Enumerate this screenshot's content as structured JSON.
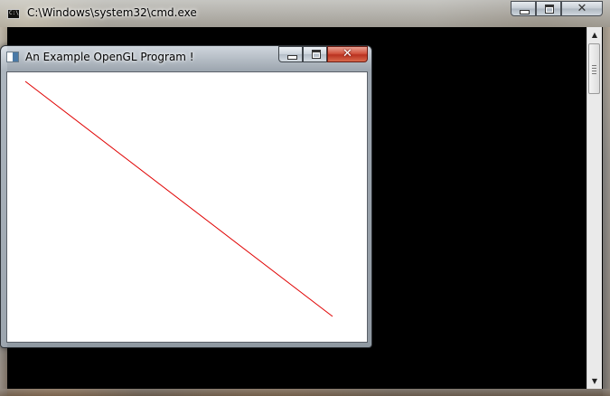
{
  "cmd_window": {
    "title": "C:\\Windows\\system32\\cmd.exe",
    "icon_text": "C:\\",
    "controls": {
      "minimize": "minimize",
      "maximize": "maximize",
      "close": "x"
    }
  },
  "gl_window": {
    "title": "An Example OpenGL Program !",
    "controls": {
      "minimize": "minimize",
      "maximize": "maximize",
      "close": "x"
    },
    "line_color": "#e00000"
  },
  "scrollbar": {
    "up_arrow": "▲",
    "down_arrow": "▼"
  },
  "icons": {
    "cmd": "cmd-window-icon",
    "gl": "opengl-window-icon",
    "minimize": "minimize-icon",
    "maximize": "maximize-icon",
    "close": "close-icon"
  },
  "close_glyph": "✕"
}
